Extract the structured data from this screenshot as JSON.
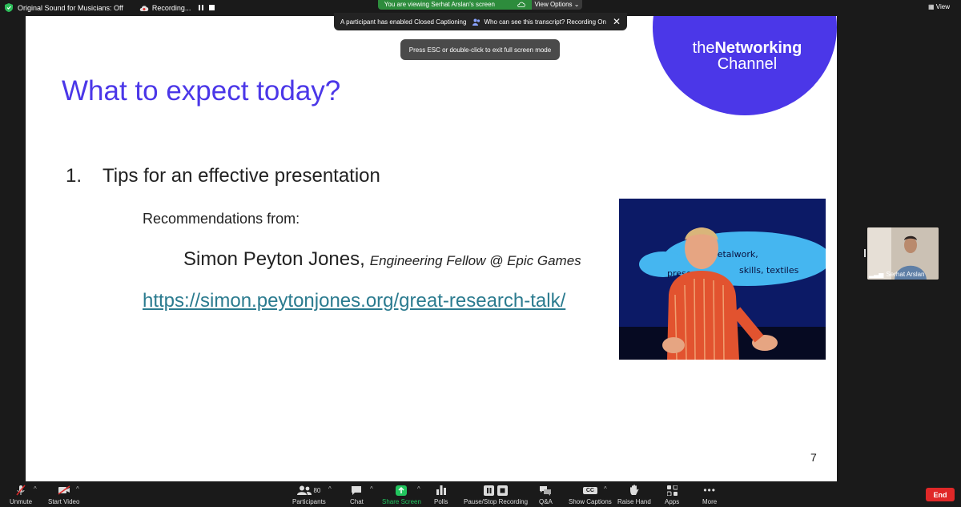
{
  "topbar": {
    "original_sound": "Original Sound for Musicians: Off",
    "recording": "Recording...",
    "viewing_banner": "You are viewing Serhat Arslan's screen",
    "view_options": "View Options",
    "view_right": "View"
  },
  "caption_bar": {
    "notice": "A participant has enabled Closed Captioning",
    "transcript_link": "Who can see this transcript? Recording On"
  },
  "toast": {
    "text": "Press ESC or double-click to exit full screen mode"
  },
  "slide": {
    "brand_prefix": "the",
    "brand_bold": "Networking",
    "brand_line2": "Channel",
    "title": "What to expect today?",
    "list_number": "1.",
    "list_text": "Tips for an effective presentation",
    "recommendations": "Recommendations from:",
    "person_name": "Simon Peyton Jones,",
    "person_role": "Engineering Fellow @ Epic Games",
    "link": "https://simon.peytonjones.org/great-research-talk/",
    "page_number": "7",
    "photo_words_1": "metalwork,",
    "photo_words_2": "skills, textiles",
    "photo_words_3": "prese"
  },
  "participant": {
    "name": "Serhat Arslan"
  },
  "toolbar": {
    "unmute": "Unmute",
    "start_video": "Start Video",
    "participants": "Participants",
    "participants_count": "80",
    "chat": "Chat",
    "share_screen": "Share Screen",
    "polls": "Polls",
    "pause_stop": "Pause/Stop Recording",
    "qa": "Q&A",
    "show_captions": "Show Captions",
    "raise_hand": "Raise Hand",
    "apps": "Apps",
    "more": "More",
    "end": "End",
    "cc_badge": "CC"
  },
  "colors": {
    "brand": "#4b37e8",
    "link": "#2b7b8f",
    "banner_green": "#2d8c3c",
    "end_red": "#e02828",
    "share_green": "#22c55e"
  }
}
